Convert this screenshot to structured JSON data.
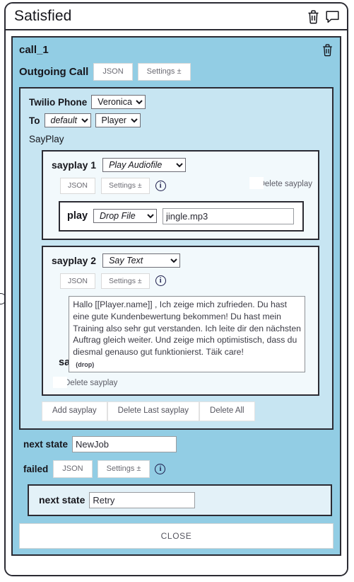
{
  "window": {
    "title": "Satisfied",
    "icons": [
      {
        "name": "delete-state-icon",
        "glyph": "trash"
      },
      {
        "name": "comment-icon",
        "glyph": "speech-bubble"
      }
    ]
  },
  "call": {
    "name": "call_1",
    "delete_icon": "trash",
    "outgoing_label": "Outgoing Call",
    "json_label": "JSON",
    "settings_label": "Settings ±"
  },
  "twilio": {
    "phone_label": "Twilio Phone",
    "phone_value": "Veronica",
    "to_label": "To",
    "to_value": "default",
    "to_target_value": "Player",
    "sayplay_heading": "SayPlay"
  },
  "sayplays": [
    {
      "name": "sayplay 1",
      "type_value": "Play Audiofile",
      "json_label": "JSON",
      "settings_label": "Settings ±",
      "info_glyph": "i",
      "delete_label": "Delete sayplay",
      "play_label": "play",
      "source_value": "Drop File",
      "file_value": "jingle.mp3"
    },
    {
      "name": "sayplay 2",
      "type_value": "Say Text",
      "json_label": "JSON",
      "settings_label": "Settings ±",
      "info_glyph": "i",
      "delete_label": "Delete sayplay",
      "say_label": "say",
      "say_sub": "(drop)",
      "text_value": "Hallo [[Player.name]] , Ich zeige mich zufrieden. Du hast eine gute Kundenbewertung bekommen! Du hast mein Training also sehr gut verstanden. Ich leite dir den nächsten Auftrag gleich weiter. Und zeige mich optimistisch, dass du diesmal genauso gut funktionierst. Täik care!"
    }
  ],
  "sayplay_actions": {
    "add_label": "Add sayplay",
    "delete_last_label": "Delete Last sayplay",
    "delete_all_label": "Delete All"
  },
  "next_state": {
    "label": "next state",
    "value": "NewJob"
  },
  "failed": {
    "label": "failed",
    "json_label": "JSON",
    "settings_label": "Settings ±",
    "info_glyph": "i",
    "next_state_label": "next state",
    "next_state_value": "Retry"
  },
  "footer": {
    "close_label": "CLOSE"
  },
  "colors": {
    "call_panel": "#92cde4",
    "twilio_panel": "#c7e5f2",
    "sayplay_panel": "#f2f9fc",
    "failed_panel": "#e3f1f8",
    "border": "#2b2b33",
    "info_icon": "#1b1b4a"
  }
}
